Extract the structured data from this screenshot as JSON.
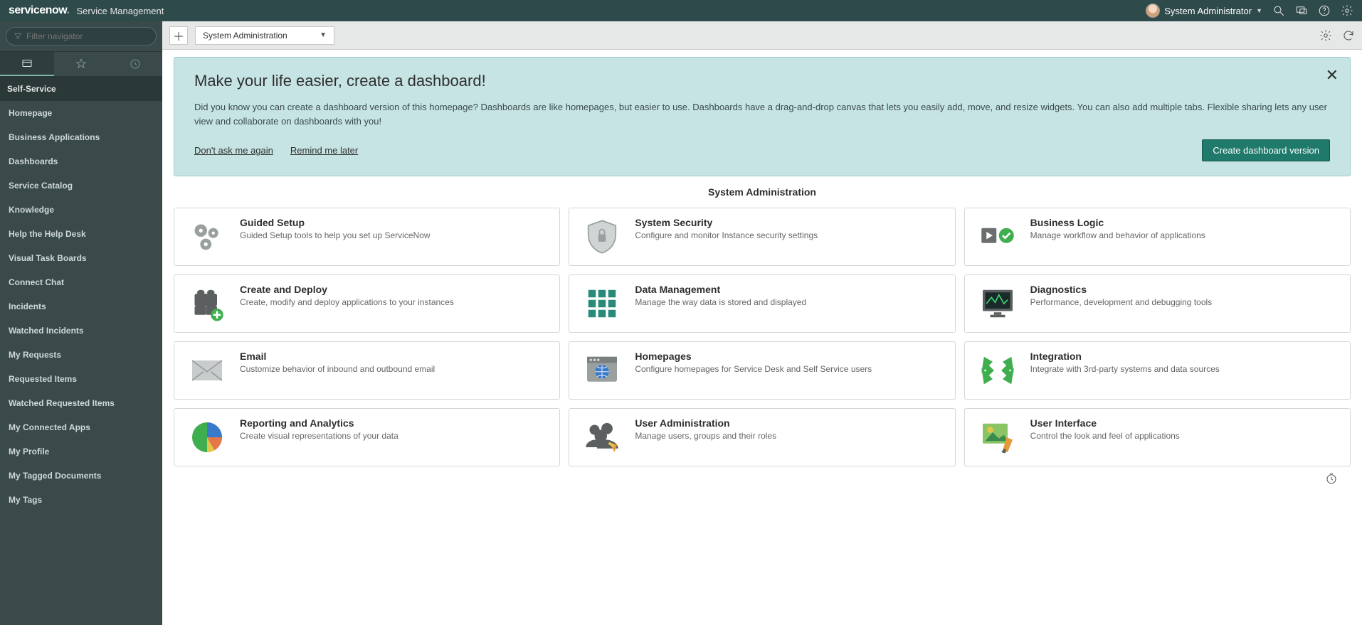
{
  "banner": {
    "logo_main": "servicenow",
    "title": "Service Management",
    "user": "System Administrator"
  },
  "filter": {
    "placeholder": "Filter navigator"
  },
  "sidebar": {
    "section": "Self-Service",
    "items": [
      "Homepage",
      "Business Applications",
      "Dashboards",
      "Service Catalog",
      "Knowledge",
      "Help the Help Desk",
      "Visual Task Boards",
      "Connect Chat",
      "Incidents",
      "Watched Incidents",
      "My Requests",
      "Requested Items",
      "Watched Requested Items",
      "My Connected Apps",
      "My Profile",
      "My Tagged Documents",
      "My Tags"
    ]
  },
  "toolbar": {
    "selected": "System Administration"
  },
  "promo": {
    "heading": "Make your life easier, create a dashboard!",
    "body": "Did you know you can create a dashboard version of this homepage? Dashboards are like homepages, but easier to use. Dashboards have a drag-and-drop canvas that lets you easily add, move, and resize widgets. You can also add multiple tabs. Flexible sharing lets any user view and collaborate on dashboards with you!",
    "dont_ask": "Don't ask me again",
    "remind": "Remind me later",
    "button": "Create dashboard version"
  },
  "page_title": "System Administration",
  "cards": [
    {
      "title": "Guided Setup",
      "desc": "Guided Setup tools to help you set up ServiceNow",
      "icon": "gears"
    },
    {
      "title": "System Security",
      "desc": "Configure and monitor Instance security settings",
      "icon": "shield"
    },
    {
      "title": "Business Logic",
      "desc": "Manage workflow and behavior of applications",
      "icon": "playcheck"
    },
    {
      "title": "Create and Deploy",
      "desc": "Create, modify and deploy applications to your instances",
      "icon": "blocks"
    },
    {
      "title": "Data Management",
      "desc": "Manage the way data is stored and displayed",
      "icon": "grid"
    },
    {
      "title": "Diagnostics",
      "desc": "Performance, development and debugging tools",
      "icon": "monitor"
    },
    {
      "title": "Email",
      "desc": "Customize behavior of inbound and outbound email",
      "icon": "mail"
    },
    {
      "title": "Homepages",
      "desc": "Configure homepages for Service Desk and Self Service users",
      "icon": "browser"
    },
    {
      "title": "Integration",
      "desc": "Integrate with 3rd-party systems and data sources",
      "icon": "arrowsin"
    },
    {
      "title": "Reporting and Analytics",
      "desc": "Create visual representations of your data",
      "icon": "pie"
    },
    {
      "title": "User Administration",
      "desc": "Manage users, groups and their roles",
      "icon": "users"
    },
    {
      "title": "User Interface",
      "desc": "Control the look and feel of applications",
      "icon": "paint"
    }
  ]
}
